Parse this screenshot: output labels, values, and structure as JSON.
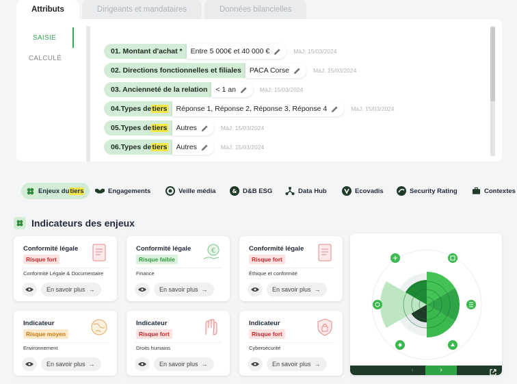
{
  "tabs": [
    {
      "label": "Attributs",
      "active": true
    },
    {
      "label": "Dirigeants et mandataires",
      "active": false
    },
    {
      "label": "Données bilancielles",
      "active": false
    }
  ],
  "side_nav": [
    {
      "label": "SAISIE",
      "active": true
    },
    {
      "label": "CALCULÉ",
      "active": false
    }
  ],
  "fields": [
    {
      "label": "01. Montant d'achat *",
      "value": "Entre 5 000€ et 40 000 €",
      "updated": "MàJ: 15/03/2024"
    },
    {
      "label": "02. Directions fonctionnelles et filiales",
      "value": "PACA Corse",
      "updated": "MàJ: 15/03/2024"
    },
    {
      "label": "03. Ancienneté de la relation",
      "value": "< 1 an",
      "updated": "MàJ: 15/03/2024"
    },
    {
      "label_pre": "04.Types de ",
      "label_hl": "tiers",
      "value": "Réponse 1, Réponse 2, Réponse 3, Réponse 4",
      "updated": "MàJ: 15/03/2024"
    },
    {
      "label_pre": "05.Types de ",
      "label_hl": "tiers",
      "value": "Autres",
      "updated": "MàJ: 15/03/2024"
    },
    {
      "label_pre": "06.Types de ",
      "label_hl": "tiers",
      "value": "Autres",
      "updated": "MàJ: 15/03/2024"
    }
  ],
  "nav_tabs": [
    {
      "label_pre": "Enjeux du ",
      "label_hl": "tiers",
      "icon": "leaf-icon",
      "active": true
    },
    {
      "label": "Engagements",
      "icon": "handshake-icon"
    },
    {
      "label": "Veille média",
      "icon": "media-icon"
    },
    {
      "label": "D&B ESG",
      "icon": "dnb-icon"
    },
    {
      "label": "Data Hub",
      "icon": "hub-icon"
    },
    {
      "label": "Ecovadis",
      "icon": "ecovadis-icon"
    },
    {
      "label": "Security Rating",
      "icon": "security-rating-icon"
    },
    {
      "label": "Contextes",
      "icon": "briefcase-icon"
    }
  ],
  "section": {
    "title": "Indicateurs des enjeux"
  },
  "cards": [
    {
      "title": "Conformité légale",
      "risk": "Risque fort",
      "level": "fort",
      "category": "Conformité Légale & Documentaire",
      "more": "En savoir plus",
      "icon": "document-icon"
    },
    {
      "title": "Conformité légale",
      "risk": "Risque faible",
      "level": "faible",
      "category": "Finance",
      "more": "En savoir plus",
      "icon": "euro-hand-icon"
    },
    {
      "title": "Conformité légale",
      "risk": "Risque fort",
      "level": "fort",
      "category": "Éthique et conformité",
      "more": "En savoir plus",
      "icon": "document-icon"
    },
    {
      "title": "Indicateur",
      "risk": "Risque moyen",
      "level": "moyen",
      "category": "Environnement",
      "more": "En savoir plus",
      "icon": "globe-icon"
    },
    {
      "title": "Indicateur",
      "risk": "Risque fort",
      "level": "fort",
      "category": "Droits humains",
      "more": "En savoir plus",
      "icon": "hands-icon"
    },
    {
      "title": "Indicateur",
      "risk": "Risque fort",
      "level": "fort",
      "category": "Cybersécurité",
      "more": "En savoir plus",
      "icon": "shield-lock-icon"
    }
  ],
  "colors": {
    "accent": "#34a853",
    "accent_light": "#d3ecd5",
    "risk_high": "#c62828",
    "risk_low": "#2e9a3e",
    "risk_medium": "#c77a12",
    "highlight": "#f5e94a",
    "radar_dark": "#1f3a29"
  },
  "radar": {
    "nav_prev": "‹",
    "nav_next": "›"
  }
}
